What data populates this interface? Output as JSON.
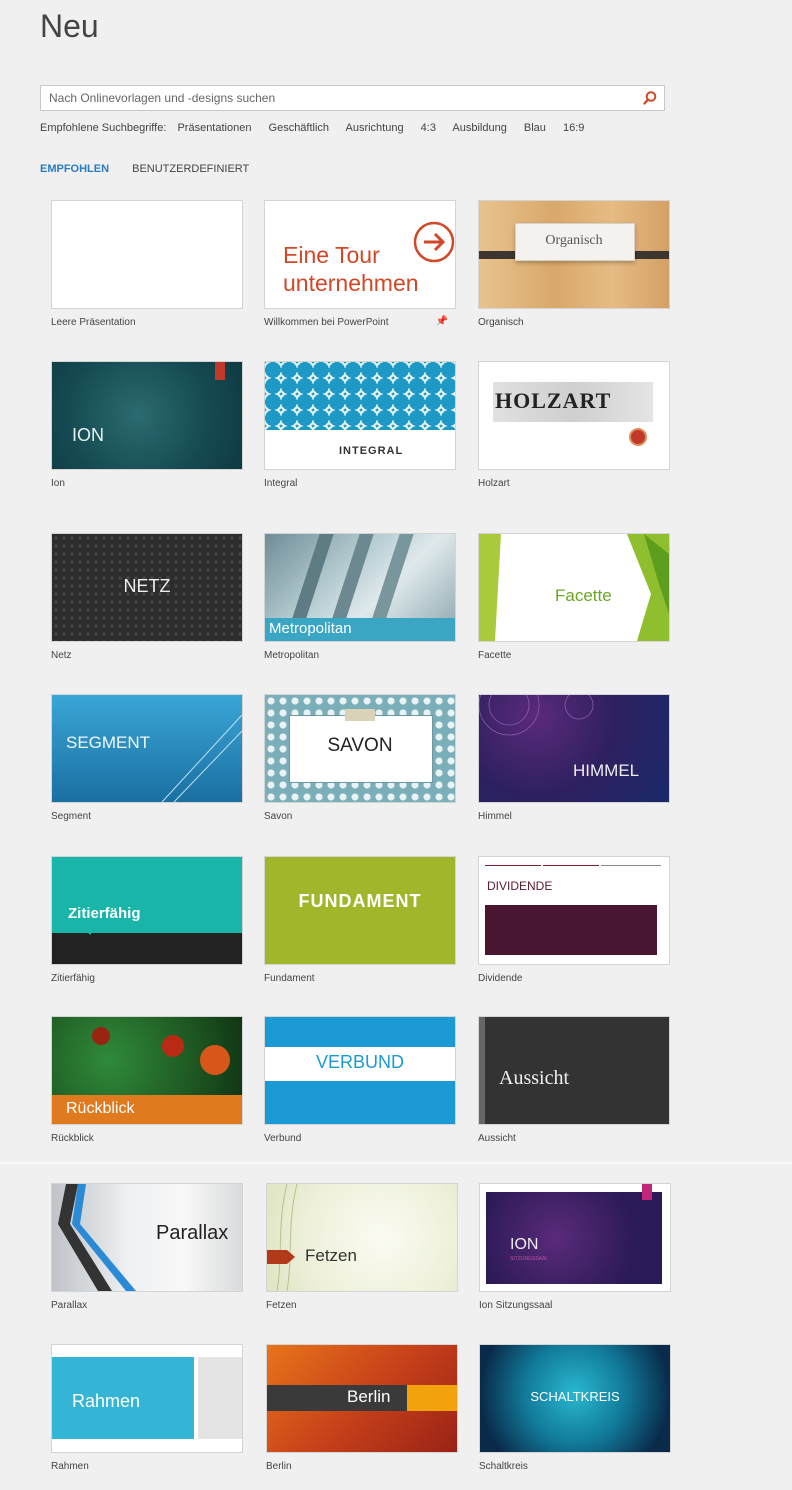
{
  "header": {
    "title": "Neu"
  },
  "search": {
    "placeholder": "Nach Onlinevorlagen und -designs suchen",
    "icon": "search-icon"
  },
  "suggestions": {
    "label": "Empfohlene Suchbegriffe:",
    "terms": [
      "Präsentationen",
      "Geschäftlich",
      "Ausrichtung",
      "4:3",
      "Ausbildung",
      "Blau",
      "16:9"
    ]
  },
  "tabs": [
    {
      "label": "EMPFOHLEN",
      "active": true
    },
    {
      "label": "BENUTZERDEFINIERT",
      "active": false
    }
  ],
  "templates": [
    {
      "caption": "Leere Präsentation",
      "thumb_text": ""
    },
    {
      "caption": "Willkommen bei PowerPoint",
      "thumb_text": "Eine Tour unternehmen",
      "thumb_line1": "Eine Tour",
      "thumb_line2": "unternehmen",
      "pinned": true
    },
    {
      "caption": "Organisch",
      "thumb_text": "Organisch"
    },
    {
      "caption": "Ion",
      "thumb_text": "ION"
    },
    {
      "caption": "Integral",
      "thumb_text": "INTEGRAL"
    },
    {
      "caption": "Holzart",
      "thumb_text": "HOLZART"
    },
    {
      "caption": "Netz",
      "thumb_text": "NETZ"
    },
    {
      "caption": "Metropolitan",
      "thumb_text": "Metropolitan"
    },
    {
      "caption": "Facette",
      "thumb_text": "Facette"
    },
    {
      "caption": "Segment",
      "thumb_text": "SEGMENT"
    },
    {
      "caption": "Savon",
      "thumb_text": "SAVON"
    },
    {
      "caption": "Himmel",
      "thumb_text": "HIMMEL"
    },
    {
      "caption": "Zitierfähig",
      "thumb_text": "Zitierfähig"
    },
    {
      "caption": "Fundament",
      "thumb_text": "FUNDAMENT"
    },
    {
      "caption": "Dividende",
      "thumb_text": "DIVIDENDE"
    },
    {
      "caption": "Rückblick",
      "thumb_text": "Rückblick"
    },
    {
      "caption": "Verbund",
      "thumb_text": "VERBUND"
    },
    {
      "caption": "Aussicht",
      "thumb_text": "Aussicht"
    },
    {
      "caption": "Parallax",
      "thumb_text": "Parallax"
    },
    {
      "caption": "Fetzen",
      "thumb_text": "Fetzen"
    },
    {
      "caption": "Ion Sitzungssaal",
      "thumb_text": "ION",
      "thumb_subtext": "SITZUNGSSAAL"
    },
    {
      "caption": "Rahmen",
      "thumb_text": "Rahmen"
    },
    {
      "caption": "Berlin",
      "thumb_text": "Berlin"
    },
    {
      "caption": "Schaltkreis",
      "thumb_text": "SCHALTKREIS"
    }
  ],
  "colors": {
    "accent": "#2b7bc0",
    "search_icon": "#d04a2a"
  }
}
